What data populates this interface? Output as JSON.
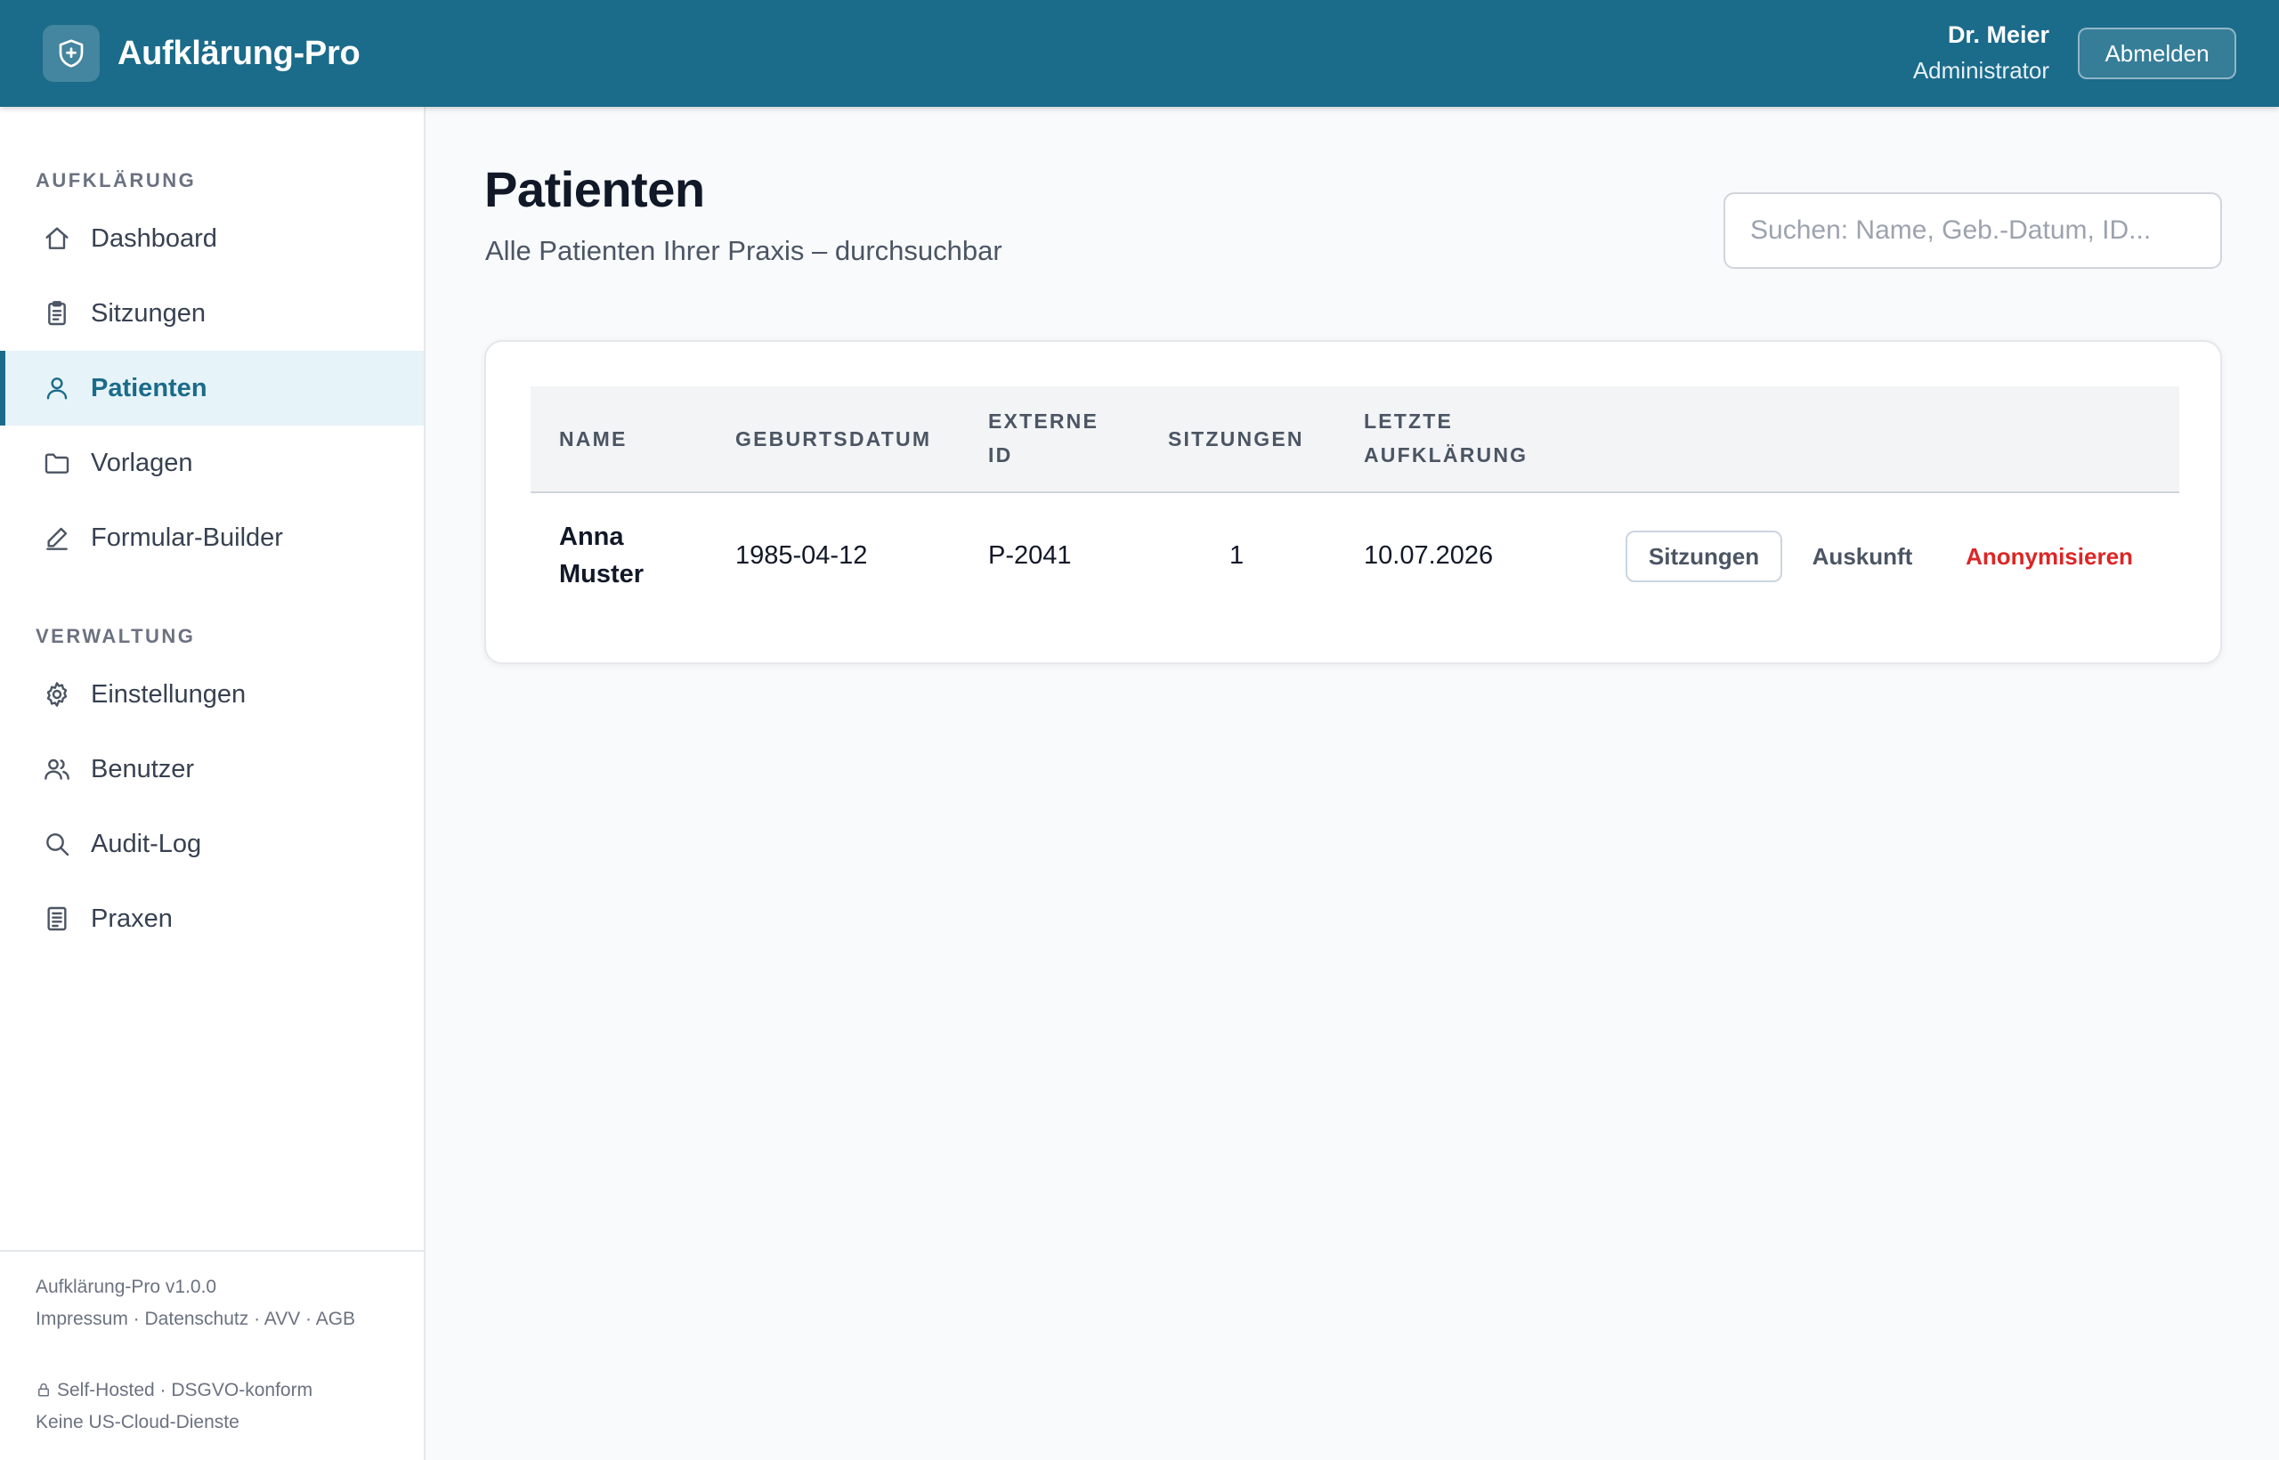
{
  "header": {
    "app_name": "Aufklärung-Pro",
    "user_name": "Dr. Meier",
    "user_role": "Administrator",
    "logout_label": "Abmelden"
  },
  "sidebar": {
    "sections": [
      {
        "title": "AUFKLÄRUNG",
        "items": [
          {
            "label": "Dashboard",
            "icon": "home-icon"
          },
          {
            "label": "Sitzungen",
            "icon": "clipboard-icon"
          },
          {
            "label": "Patienten",
            "icon": "user-icon",
            "active": true
          },
          {
            "label": "Vorlagen",
            "icon": "folder-icon"
          },
          {
            "label": "Formular-Builder",
            "icon": "pencil-icon"
          }
        ]
      },
      {
        "title": "VERWALTUNG",
        "items": [
          {
            "label": "Einstellungen",
            "icon": "gear-icon"
          },
          {
            "label": "Benutzer",
            "icon": "users-icon"
          },
          {
            "label": "Audit-Log",
            "icon": "search-icon"
          },
          {
            "label": "Praxen",
            "icon": "document-icon"
          }
        ]
      }
    ],
    "footer": {
      "version": "Aufklärung-Pro v1.0.0",
      "links": "Impressum · Datenschutz · AVV · AGB",
      "hosting": "Self-Hosted · DSGVO-konform",
      "cloud": "Keine US-Cloud-Dienste"
    }
  },
  "main": {
    "title": "Patienten",
    "subtitle": "Alle Patienten Ihrer Praxis – durchsuchbar",
    "search": {
      "placeholder": "Suchen: Name, Geb.-Datum, ID...",
      "value": ""
    },
    "table": {
      "columns": [
        "NAME",
        "GEBURTSDATUM",
        "EXTERNE ID",
        "SITZUNGEN",
        "LETZTE AUFKLÄRUNG"
      ],
      "rows": [
        {
          "name": "Anna Muster",
          "birthdate": "1985-04-12",
          "external_id": "P-2041",
          "sessions": "1",
          "last_consent": "10.07.2026",
          "actions": {
            "sessions": "Sitzungen",
            "info": "Auskunft",
            "anonymize": "Anonymisieren"
          }
        }
      ]
    }
  },
  "colors": {
    "header_bg": "#1b6b8a",
    "accent": "#1b6b8a",
    "danger": "#dc2626"
  }
}
